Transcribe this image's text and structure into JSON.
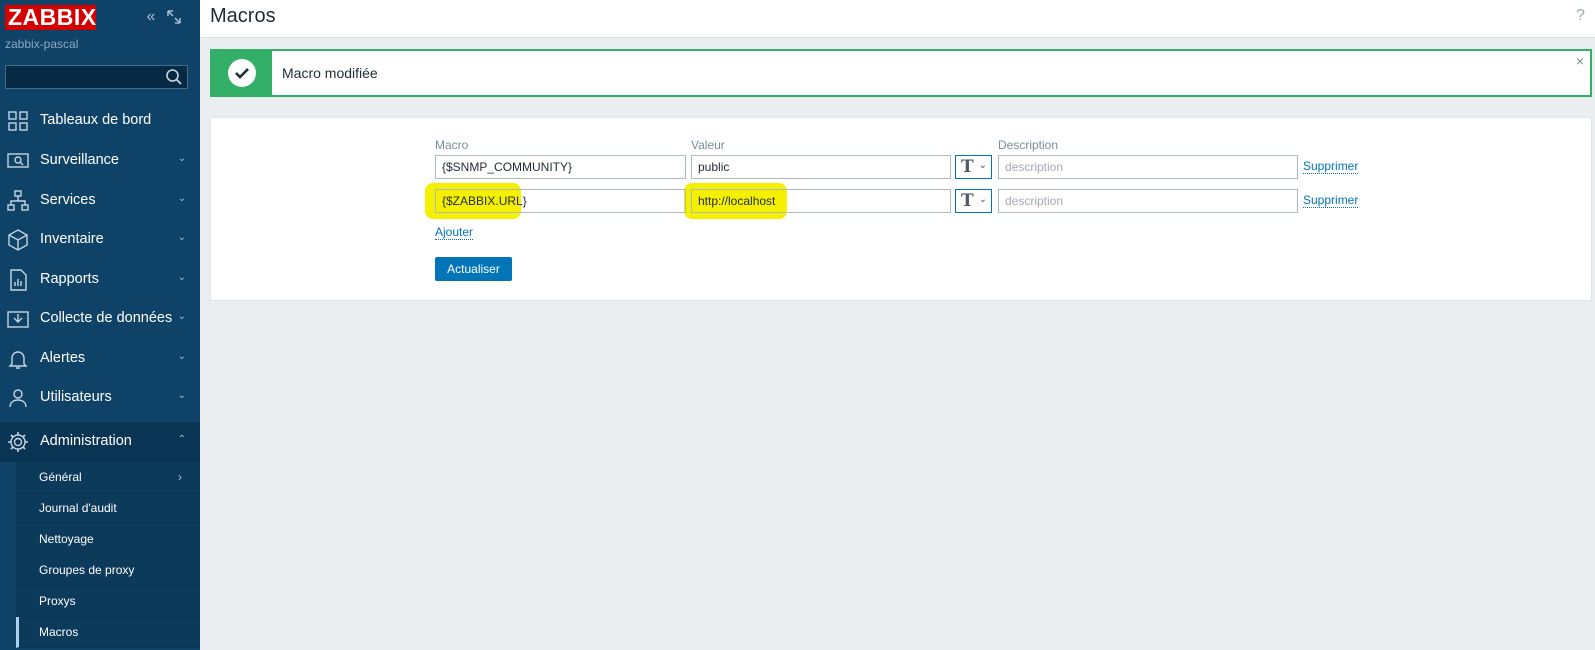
{
  "app": {
    "logo_text": "ZABBIX",
    "server_name": "zabbix-pascal",
    "search_placeholder": ""
  },
  "nav": {
    "items": [
      {
        "label": "Tableaux de bord",
        "icon": "dashboard-icon"
      },
      {
        "label": "Surveillance",
        "icon": "monitoring-icon"
      },
      {
        "label": "Services",
        "icon": "services-icon"
      },
      {
        "label": "Inventaire",
        "icon": "inventory-icon"
      },
      {
        "label": "Rapports",
        "icon": "reports-icon"
      },
      {
        "label": "Collecte de données",
        "icon": "data-collection-icon"
      },
      {
        "label": "Alertes",
        "icon": "alerts-icon"
      },
      {
        "label": "Utilisateurs",
        "icon": "users-icon"
      },
      {
        "label": "Administration",
        "icon": "gear-icon"
      }
    ],
    "submenu": [
      {
        "label": "Général"
      },
      {
        "label": "Journal d'audit"
      },
      {
        "label": "Nettoyage"
      },
      {
        "label": "Groupes de proxy"
      },
      {
        "label": "Proxys"
      },
      {
        "label": "Macros"
      }
    ]
  },
  "header": {
    "title": "Macros",
    "help": "?"
  },
  "message": {
    "text": "Macro modifiée",
    "close": "×"
  },
  "form": {
    "headers": {
      "macro": "Macro",
      "value": "Valeur",
      "description": "Description"
    },
    "rows": [
      {
        "macro": "{$SNMP_COMMUNITY}",
        "value": "public",
        "description_placeholder": "description",
        "remove": "Supprimer"
      },
      {
        "macro": "{$ZABBIX.URL}",
        "value": "http://localhost",
        "description_placeholder": "description",
        "remove": "Supprimer"
      }
    ],
    "add_label": "Ajouter",
    "update_label": "Actualiser",
    "type_glyph": "T"
  },
  "colors": {
    "sidebar": "#0e4266",
    "accent": "#0275b8",
    "success": "#34af67",
    "highlight": "#f5f000",
    "logo": "#d40000"
  }
}
